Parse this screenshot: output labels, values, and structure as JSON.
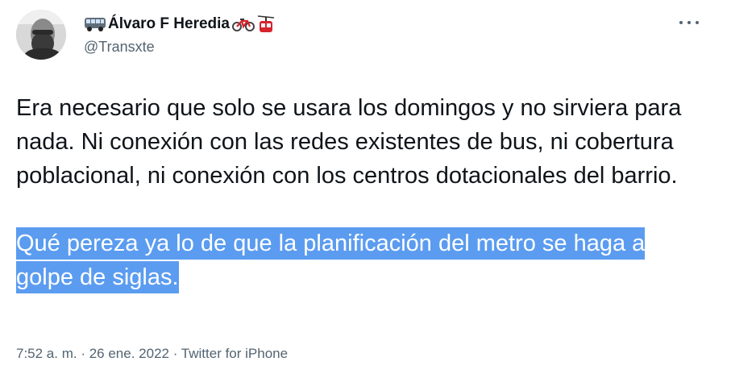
{
  "tweet": {
    "author": {
      "name_prefix_icon": "bus-icon",
      "name": "Álvaro F Heredia",
      "name_suffix_icons": [
        "bicycle-icon",
        "aerial-tramway-icon"
      ],
      "handle": "@Transxte"
    },
    "paragraphs": [
      "Era necesario que solo se usara los domingos y no sirviera para nada. Ni conexión con las redes existentes de bus, ni cobertura poblacional, ni conexión con los centros dotacionales del barrio.",
      "Qué pereza ya lo de que la planificación del metro se haga a golpe de siglas."
    ],
    "highlight_color": "#5b9cf0",
    "time": "7:52 a. m.",
    "separator": " · ",
    "date": "26 ene. 2022",
    "source": "Twitter for iPhone"
  }
}
